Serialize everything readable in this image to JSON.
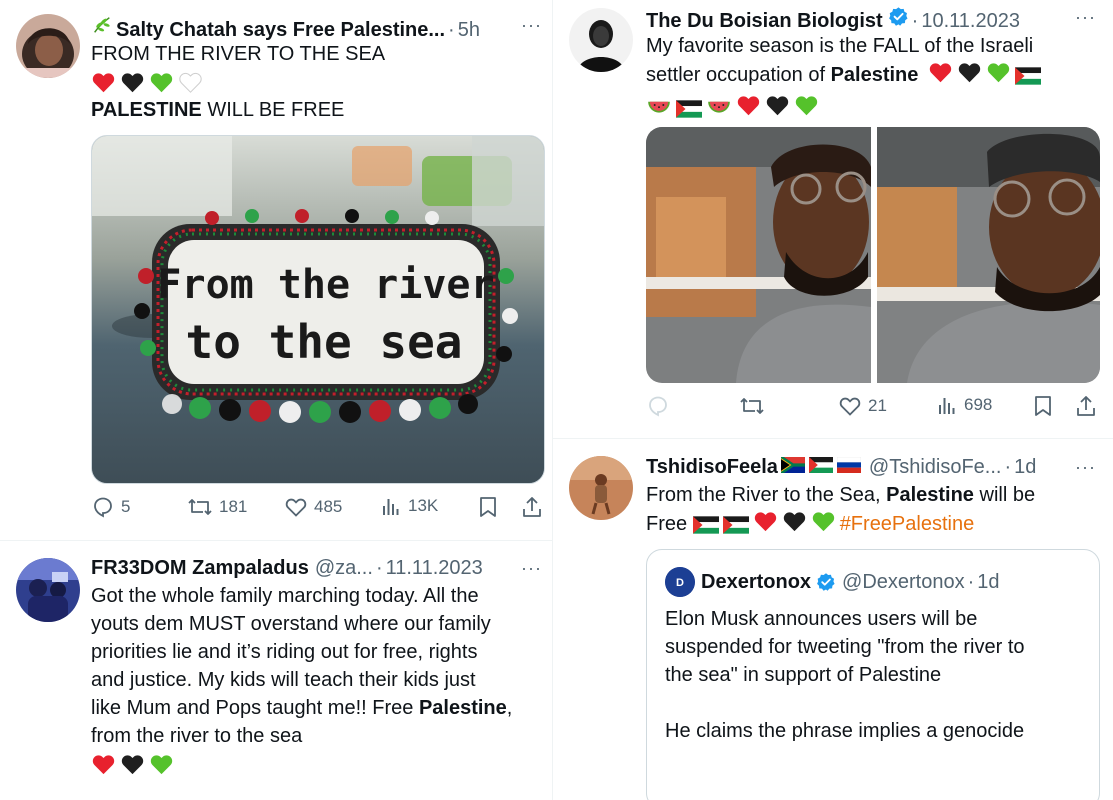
{
  "tweets": {
    "t1": {
      "name": "Salty Chatah says Free Palestine...",
      "name_emoji": "herb-icon",
      "dot": "·",
      "time": "5h",
      "more": "···",
      "line1": "FROM THE RIVER TO THE SEA",
      "line3_bold": "PALESTINE",
      "line3_rest": " WILL BE FREE",
      "image_text_1": "From the river",
      "image_text_2": "to the sea",
      "replies": "5",
      "retweets": "181",
      "likes": "485",
      "views": "13K"
    },
    "t2": {
      "name": "FR33DOM Zampaladus",
      "handle": "@za...",
      "dot": "·",
      "time": "11.11.2023",
      "more": "···",
      "text_1": "Got the whole family marching today. All the",
      "text_2": "youts dem MUST overstand where our family",
      "text_3": "priorities lie and it’s riding out for free, rights",
      "text_4": "and justice. My kids will teach their kids just",
      "text_5_a": "like Mum and Pops taught me!! Free ",
      "text_5_bold": "Palestine",
      "text_5_b": ",",
      "text_6": "from the river to the sea"
    },
    "t3": {
      "name": "The Du Boisian Biologist",
      "dot": "·",
      "time": "10.11.2023",
      "more": "···",
      "text_1": "My favorite season is the FALL of the Israeli",
      "text_2_a": "settler occupation of ",
      "text_2_bold": "Palestine",
      "replies": "",
      "retweets": "",
      "likes": "21",
      "views": "698"
    },
    "t4": {
      "name": "TshidisoFeela",
      "handle": "@TshidisoFe...",
      "dot": "·",
      "time": "1d",
      "more": "···",
      "text_1_a": "From the River to the Sea, ",
      "text_1_bold": "Palestine",
      "text_1_b": " will be",
      "text_2_a": "Free ",
      "hashtag": "#FreePalestine",
      "quote": {
        "name": "Dexertonox",
        "handle": "@Dexertonox",
        "dot": "·",
        "time": "1d",
        "text_1": "Elon Musk announces users will be",
        "text_2": "suspended for tweeting \"from the river to",
        "text_3": "the sea\" in support of Palestine",
        "text_4": "He claims the phrase implies a genocide"
      }
    }
  },
  "colors": {
    "red_heart": "#e8212e",
    "black_heart": "#1f1f1f",
    "green_heart": "#55c22b",
    "verified": "#1d9bf0",
    "hashtag": "#e7710e",
    "muted": "#536471"
  }
}
